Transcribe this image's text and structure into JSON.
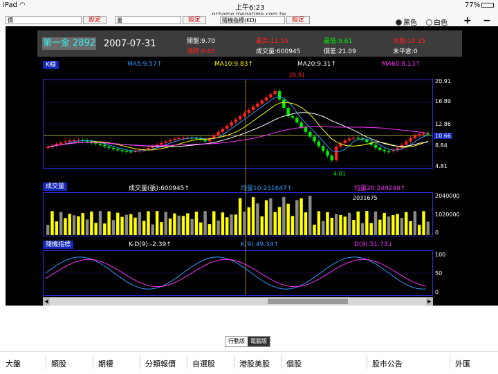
{
  "status": {
    "device": "iPad",
    "time": "上午6:23",
    "battery": "77%"
  },
  "url": "pchome.megatime.com.tw",
  "controls": {
    "select1": "價",
    "select2": "量",
    "select3": "隨機指標(KD)",
    "confirm1": "設定",
    "confirm2": "設定",
    "confirm3": "設定",
    "radio_black": "黑色",
    "radio_white": "白色",
    "plus": "+",
    "minus": "−"
  },
  "header": {
    "stock": "第一金 2892",
    "date": "2007-07-31",
    "open": "開盤:9.70",
    "high": "最高:11.50",
    "low": "最低:9.61",
    "close": "收盤:10.35",
    "change": "漲跌:0.65",
    "volume": "成交量:600945",
    "range": "價差:21.09",
    "unchanged": "未平倉:0"
  },
  "kline": {
    "label": "K線",
    "ma5": "MA5:9.57↑",
    "ma10": "MA10:9.83↑",
    "ma20": "MA20:9.31↑",
    "ma60": "MA60:8.13↑",
    "y_ticks": [
      "20.91",
      "16.89",
      "12.86",
      "10.66",
      "8.84",
      "4.81"
    ],
    "high_label": "20.91",
    "low_label": "4.81"
  },
  "volume_panel": {
    "label": "成交量",
    "volume": "成交量(張):600945↑",
    "avg10": "均量10:231647↑",
    "avg20": "均量20:249240↑",
    "peak_label": "2031675",
    "y_ticks": [
      "2040000",
      "1020000",
      "0"
    ]
  },
  "kd_panel": {
    "label": "隨機指標",
    "kd": "K-D(9):-2.39↑",
    "k": "K(9):49.34↑",
    "d": "D(9):51.73↓",
    "y_ticks": [
      "100",
      "50",
      "0"
    ]
  },
  "version": {
    "mobile": "行動版",
    "desktop": "電腦版"
  },
  "nav": [
    "大盤",
    "類股",
    "期權",
    "分類報價",
    "自選股",
    "港股美股",
    "個股",
    "股市公告",
    "外匯"
  ],
  "colors": {
    "up": "#ff2020",
    "down": "#00ee00",
    "ma5": "#2f9bff",
    "ma10": "#ffff00",
    "ma20": "#ffffff",
    "ma60": "#ff30ff",
    "panel_border": "#2a2ad0"
  }
}
